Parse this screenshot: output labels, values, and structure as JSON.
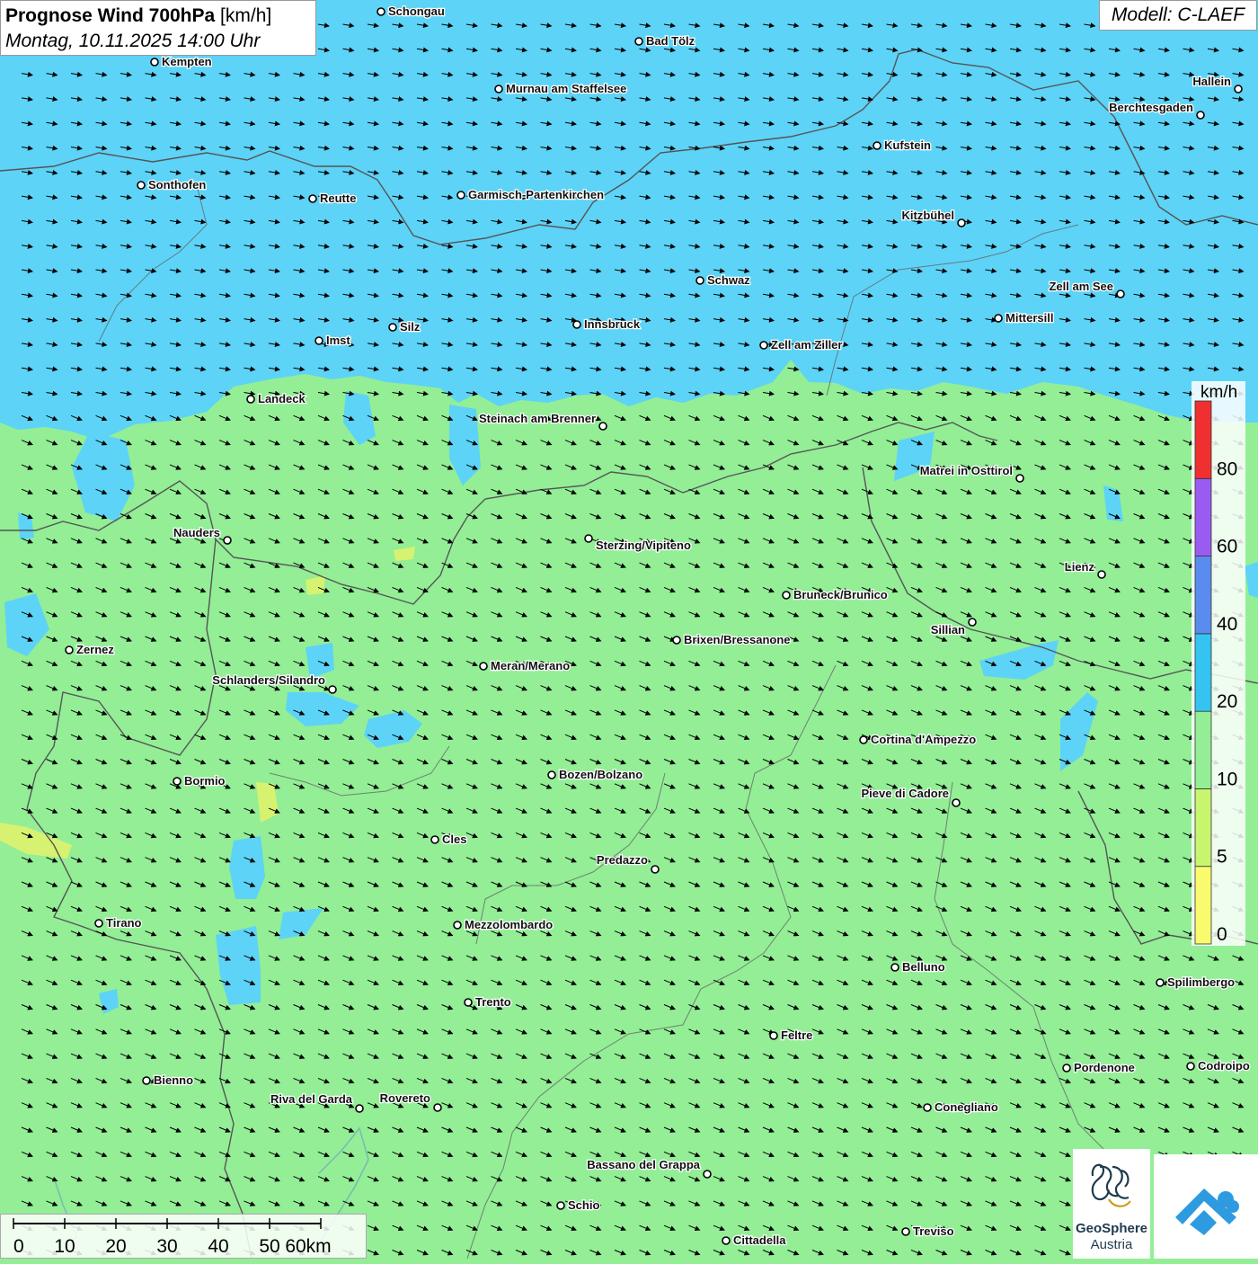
{
  "header": {
    "title": "Prognose Wind 700hPa",
    "unit": "[km/h]",
    "datetime": "Montag, 10.11.2025 14:00 Uhr",
    "model": "Modell: C-LAEF"
  },
  "legend": {
    "unit": "km/h",
    "bins": [
      {
        "label": "0",
        "color": "#fafa6e"
      },
      {
        "label": "5",
        "color": "#c8f56e"
      },
      {
        "label": "10",
        "color": "#93ee96"
      },
      {
        "label": "20",
        "color": "#35c4f2"
      },
      {
        "label": "40",
        "color": "#5a8cf0"
      },
      {
        "label": "60",
        "color": "#9a5cf0"
      },
      {
        "label": "80",
        "color": "#f03030"
      }
    ]
  },
  "scale_bar": {
    "ticks": [
      "0",
      "10",
      "20",
      "30",
      "40",
      "50",
      "60km"
    ]
  },
  "logos": {
    "geosphere_line1": "GeoSphere",
    "geosphere_line2": "Austria"
  },
  "colors": {
    "calm_green": "#93ee96",
    "wind_blue": "#5dd3f7",
    "border": "#555555"
  },
  "cities": [
    {
      "name": "Schongau"
    },
    {
      "name": "Bad Tölz"
    },
    {
      "name": "Kempten"
    },
    {
      "name": "Murnau am Staffelsee"
    },
    {
      "name": "Hallein"
    },
    {
      "name": "Berchtesgaden"
    },
    {
      "name": "Kufstein"
    },
    {
      "name": "Sonthofen"
    },
    {
      "name": "Reutte"
    },
    {
      "name": "Garmisch-Partenkirchen"
    },
    {
      "name": "Kitzbühel"
    },
    {
      "name": "Schwaz"
    },
    {
      "name": "Zell am See"
    },
    {
      "name": "Mittersill"
    },
    {
      "name": "Innsbruck"
    },
    {
      "name": "Silz"
    },
    {
      "name": "Imst"
    },
    {
      "name": "Zell am Ziller"
    },
    {
      "name": "Landeck"
    },
    {
      "name": "Steinach am Brenner"
    },
    {
      "name": "Matrei in Osttirol"
    },
    {
      "name": "Nauders"
    },
    {
      "name": "Sterzing/Vipiteno"
    },
    {
      "name": "Lienz"
    },
    {
      "name": "Bruneck/Brunico"
    },
    {
      "name": "Sillian"
    },
    {
      "name": "Zernez"
    },
    {
      "name": "Brixen/Bressanone"
    },
    {
      "name": "Meran/Merano"
    },
    {
      "name": "Schlanders/Silandro"
    },
    {
      "name": "Cortina d'Ampezzo"
    },
    {
      "name": "Bozen/Bolzano"
    },
    {
      "name": "Bormio"
    },
    {
      "name": "Pieve di Cadore"
    },
    {
      "name": "Cles"
    },
    {
      "name": "Predazzo"
    },
    {
      "name": "Tirano"
    },
    {
      "name": "Mezzolombardo"
    },
    {
      "name": "Belluno"
    },
    {
      "name": "Spilimbergo"
    },
    {
      "name": "Trento"
    },
    {
      "name": "Feltre"
    },
    {
      "name": "Pordenone"
    },
    {
      "name": "Codroipo"
    },
    {
      "name": "Bienno"
    },
    {
      "name": "Riva del Garda"
    },
    {
      "name": "Rovereto"
    },
    {
      "name": "Conegliano"
    },
    {
      "name": "Bassano del Grappa"
    },
    {
      "name": "Schio"
    },
    {
      "name": "Treviso"
    },
    {
      "name": "Cittadella"
    }
  ]
}
